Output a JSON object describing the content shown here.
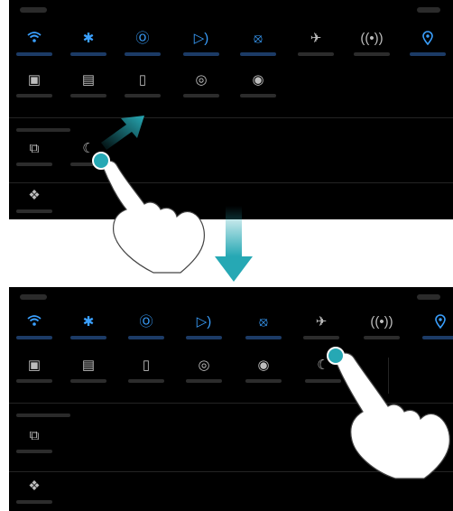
{
  "icons": {
    "wifi": "wifi-icon",
    "bluetooth": "bluetooth-icon",
    "data": "mobile-data-icon",
    "sound": "sound-icon",
    "rotate": "auto-rotate-icon",
    "airplane": "airplane-icon",
    "hotspot": "hotspot-icon",
    "location": "location-icon",
    "screenshot": "screenshot-icon",
    "recorder": "screen-recorder-icon",
    "nfc": "nfc-icon",
    "huawei_share": "huawei-share-icon",
    "eye": "eye-comfort-icon",
    "moon": "do-not-disturb-icon",
    "multiscreen": "multi-screen-icon",
    "settings": "settings-icon"
  },
  "colors": {
    "accent": "#3aa0ff",
    "arrow_teal": "#26a8b4"
  }
}
